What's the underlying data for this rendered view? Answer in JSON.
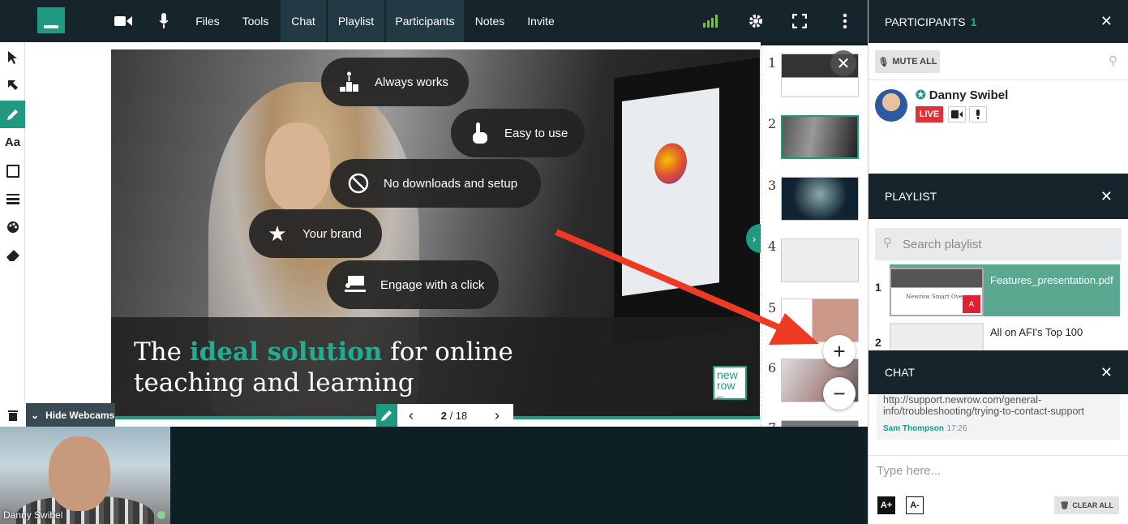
{
  "topbar": {
    "nav": [
      "Files",
      "Tools",
      "Chat",
      "Playlist",
      "Participants",
      "Notes",
      "Invite"
    ],
    "active_nav": [
      "Chat",
      "Playlist",
      "Participants"
    ],
    "signal_color": "#7ac043"
  },
  "slide": {
    "pills": [
      "Always works",
      "Easy to use",
      "No downloads and setup",
      "Your brand",
      "Engage with a click"
    ],
    "headline_pre": "The ",
    "headline_accent": "ideal solution",
    "headline_post": " for online teaching and learning",
    "logo_line1": "new",
    "logo_line2": "row",
    "logo_line3": "–"
  },
  "pager": {
    "current": "2",
    "total": "/ 18"
  },
  "thumbnails": [
    "1",
    "2",
    "3",
    "4",
    "5",
    "6",
    "7"
  ],
  "webcams": {
    "hide_label": "Hide Webcams",
    "name": "Danny Swibel"
  },
  "participants": {
    "title": "PARTICIPANTS",
    "count": "1",
    "mute_all": "MUTE ALL",
    "name": "Danny Swibel",
    "live": "LIVE"
  },
  "playlist": {
    "title": "PLAYLIST",
    "search_placeholder": "Search playlist",
    "items": [
      {
        "num": "1",
        "name": "Features_presentation.pdf",
        "thumb_caption": "Newrow Smart Overview"
      },
      {
        "num": "2",
        "name": "All on AFI's Top 100"
      }
    ]
  },
  "chat": {
    "title": "CHAT",
    "message": "http://support.newrow.com/general-info/troubleshooting/trying-to-contact-support",
    "author": "Sam Thompson",
    "time": "17:26",
    "input_placeholder": "Type here...",
    "font_up": "A+",
    "font_down": "A-",
    "clear_all": "CLEAR ALL"
  },
  "colors": {
    "accent": "#1f9a80",
    "dark": "#16242b",
    "live": "#e0303a",
    "arrow": "#ee3a23"
  }
}
